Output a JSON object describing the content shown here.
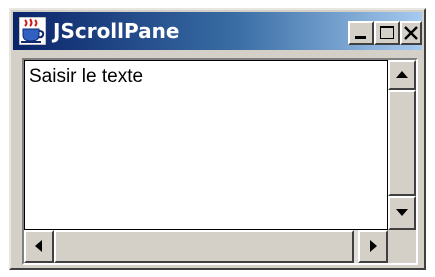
{
  "window": {
    "title": "JScrollPane",
    "icon": "java-cup-icon",
    "controls": {
      "minimize_icon": "minimize-icon",
      "maximize_icon": "maximize-icon",
      "close_icon": "close-icon"
    }
  },
  "content": {
    "text": "Saisir le texte"
  },
  "scrollbars": {
    "vertical": {
      "up_icon": "arrow-up-icon",
      "down_icon": "arrow-down-icon"
    },
    "horizontal": {
      "left_icon": "arrow-left-icon",
      "right_icon": "arrow-right-icon"
    }
  },
  "colors": {
    "title_gradient_start": "#0a246a",
    "title_gradient_end": "#a6caf0",
    "face": "#d4d0c8"
  }
}
